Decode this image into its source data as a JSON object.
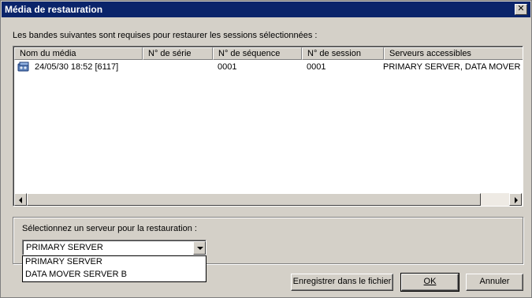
{
  "window": {
    "title": "Média de restauration",
    "close_label": "✕"
  },
  "instructions": "Les bandes suivantes sont requises pour restaurer les sessions sélectionnées :",
  "table": {
    "columns": [
      "Nom du média",
      "N° de série",
      "N° de séquence",
      "N° de session",
      "Serveurs accessibles"
    ],
    "rows": [
      {
        "media_name": "24/05/30 18:52 [6117]",
        "serial": "",
        "sequence": "0001",
        "session": "0001",
        "servers": "PRIMARY SERVER, DATA MOVER S",
        "icon": "tape-media-icon"
      }
    ]
  },
  "server_select": {
    "label": "Sélectionnez un serveur pour la restauration :",
    "value": "PRIMARY SERVER",
    "options": [
      "PRIMARY SERVER",
      "DATA MOVER SERVER B"
    ]
  },
  "buttons": {
    "save_label": "Enregistrer dans le fichier",
    "ok_label": "OK",
    "cancel_label": "Annuler"
  },
  "colors": {
    "titlebar": "#0a246a",
    "face": "#d4d0c8"
  }
}
